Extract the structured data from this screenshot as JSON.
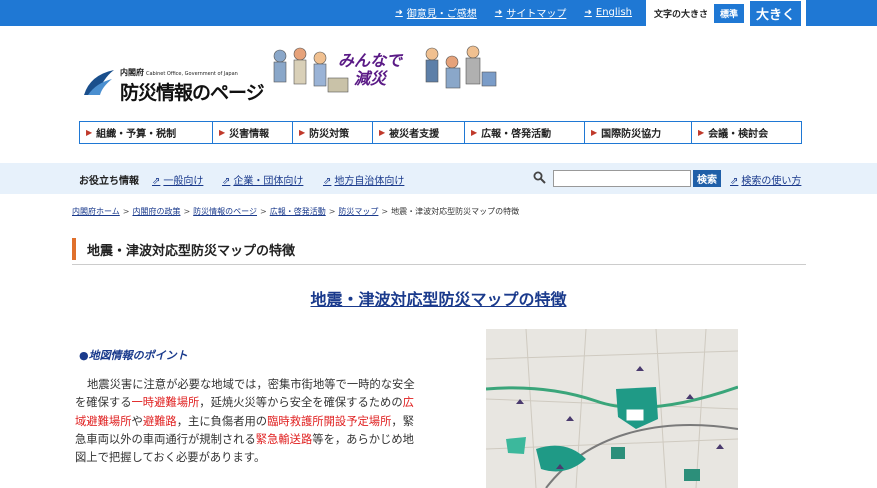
{
  "topbar": {
    "links": [
      "御意見・ご感想",
      "サイトマップ",
      "English"
    ],
    "font_size_label": "文字の大きさ",
    "font_standard": "標準",
    "font_large": "大きく"
  },
  "header": {
    "cabinet": "内閣府",
    "cabinet_en": "Cabinet Office, Government of Japan",
    "site_title": "防災情報のページ",
    "slogan_line1": "みんなで",
    "slogan_line2": "減災"
  },
  "global_nav": [
    "組織・予算・税制",
    "災害情報",
    "防災対策",
    "被災者支援",
    "広報・啓発活動",
    "国際防災協力",
    "会議・検討会"
  ],
  "helpful": {
    "label": "お役立ち情報",
    "links": [
      "一般向け",
      "企業・団体向け",
      "地方自治体向け"
    ]
  },
  "search": {
    "button": "検索",
    "help_link": "検索の使い方"
  },
  "breadcrumb": [
    "内閣府ホーム",
    "内閣府の政策",
    "防災情報のページ",
    "広報・啓発活動",
    "防災マップ"
  ],
  "breadcrumb_current": "地震・津波対応型防災マップの特徴",
  "page_heading": "地震・津波対応型防災マップの特徴",
  "main_title": "地震・津波対応型防災マップの特徴",
  "point_heading": "●地図情報のポイント",
  "body": {
    "t1": "地震災害に注意が必要な地域では，密集市街地等で一時的な安全を確保する",
    "r1": "一時避難場所",
    "t2": "，延焼火災等から安全を確保するための",
    "r2": "広域避難場所",
    "t3": "や",
    "r3": "避難路",
    "t4": "，主に負傷者用の",
    "r4": "臨時救護所開設予定場所",
    "t5": "，緊急車両以外の車両通行が規制される",
    "r5": "緊急輸送路",
    "t6": "等を，あらかじめ地図上で把握しておく必要があります。"
  },
  "colors": {
    "top_bar": "#1f78d4",
    "link": "#1a3a8c",
    "accent_orange": "#e0702c",
    "highlight_red": "#e02020",
    "help_bar": "#e7f1fb"
  },
  "icons": [
    "arrow-right-icon",
    "external-link-icon",
    "search-icon",
    "triangle-icon",
    "government-emblem-icon"
  ]
}
